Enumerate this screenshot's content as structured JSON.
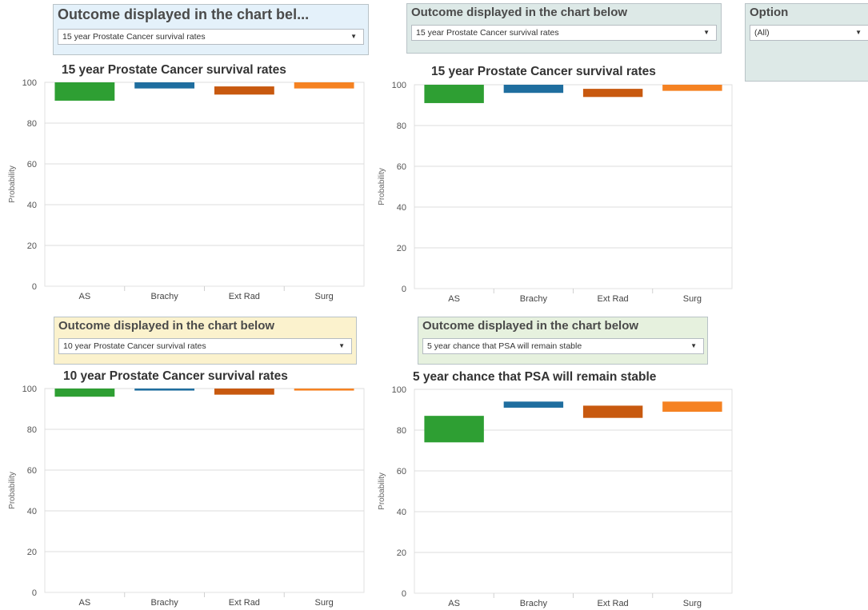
{
  "filters": [
    {
      "title": "Outcome displayed in the chart bel...",
      "value": "15 year Prostate Cancer survival rates",
      "bg": "#e4f1fa"
    },
    {
      "title": "Outcome displayed in the chart below",
      "value": "15 year Prostate Cancer survival rates",
      "bg": "#dde9e7"
    },
    {
      "title": "Option",
      "value": "(All)",
      "bg": "#dde9e7"
    },
    {
      "title": "Outcome displayed in the chart below",
      "value": "10 year Prostate Cancer survival rates",
      "bg": "#fbf2cd"
    },
    {
      "title": "Outcome displayed in the chart below",
      "value": "5 year chance that PSA will remain stable",
      "bg": "#e6f1de"
    }
  ],
  "colors": {
    "AS": "#2e9f33",
    "Brachy": "#1f6e9f",
    "Ext Rad": "#c8590f",
    "Surg": "#f58222"
  },
  "chart_data": [
    {
      "type": "bar",
      "title": "15 year Prostate Cancer survival rates",
      "ylabel": "Probability",
      "ylim": [
        0,
        100
      ],
      "yticks": [
        "0",
        "20",
        "40",
        "60",
        "80",
        "100"
      ],
      "grid": true,
      "categories": [
        "AS",
        "Brachy",
        "Ext Rad",
        "Surg"
      ],
      "ranges": [
        [
          91,
          100
        ],
        [
          97,
          100
        ],
        [
          94,
          98
        ],
        [
          97,
          100
        ]
      ]
    },
    {
      "type": "bar",
      "title": "15 year Prostate Cancer survival rates",
      "ylabel": "Probability",
      "ylim": [
        0,
        100
      ],
      "yticks": [
        "0",
        "20",
        "40",
        "60",
        "80",
        "100"
      ],
      "grid": true,
      "categories": [
        "AS",
        "Brachy",
        "Ext Rad",
        "Surg"
      ],
      "ranges": [
        [
          91,
          100
        ],
        [
          96,
          100
        ],
        [
          94,
          98
        ],
        [
          97,
          100
        ]
      ]
    },
    {
      "type": "bar",
      "title": "10 year Prostate Cancer survival rates",
      "ylabel": "Probability",
      "ylim": [
        0,
        100
      ],
      "yticks": [
        "0",
        "20",
        "40",
        "60",
        "80",
        "100"
      ],
      "grid": true,
      "categories": [
        "AS",
        "Brachy",
        "Ext Rad",
        "Surg"
      ],
      "ranges": [
        [
          96,
          100
        ],
        [
          99,
          100
        ],
        [
          97,
          100
        ],
        [
          99,
          100
        ]
      ]
    },
    {
      "type": "bar",
      "title": "5 year chance that PSA will remain stable",
      "ylabel": "Probability",
      "ylim": [
        0,
        100
      ],
      "yticks": [
        "0",
        "20",
        "40",
        "60",
        "80",
        "100"
      ],
      "grid": true,
      "categories": [
        "AS",
        "Brachy",
        "Ext Rad",
        "Surg"
      ],
      "ranges": [
        [
          74,
          87
        ],
        [
          91,
          94
        ],
        [
          86,
          92
        ],
        [
          89,
          94
        ]
      ]
    }
  ]
}
